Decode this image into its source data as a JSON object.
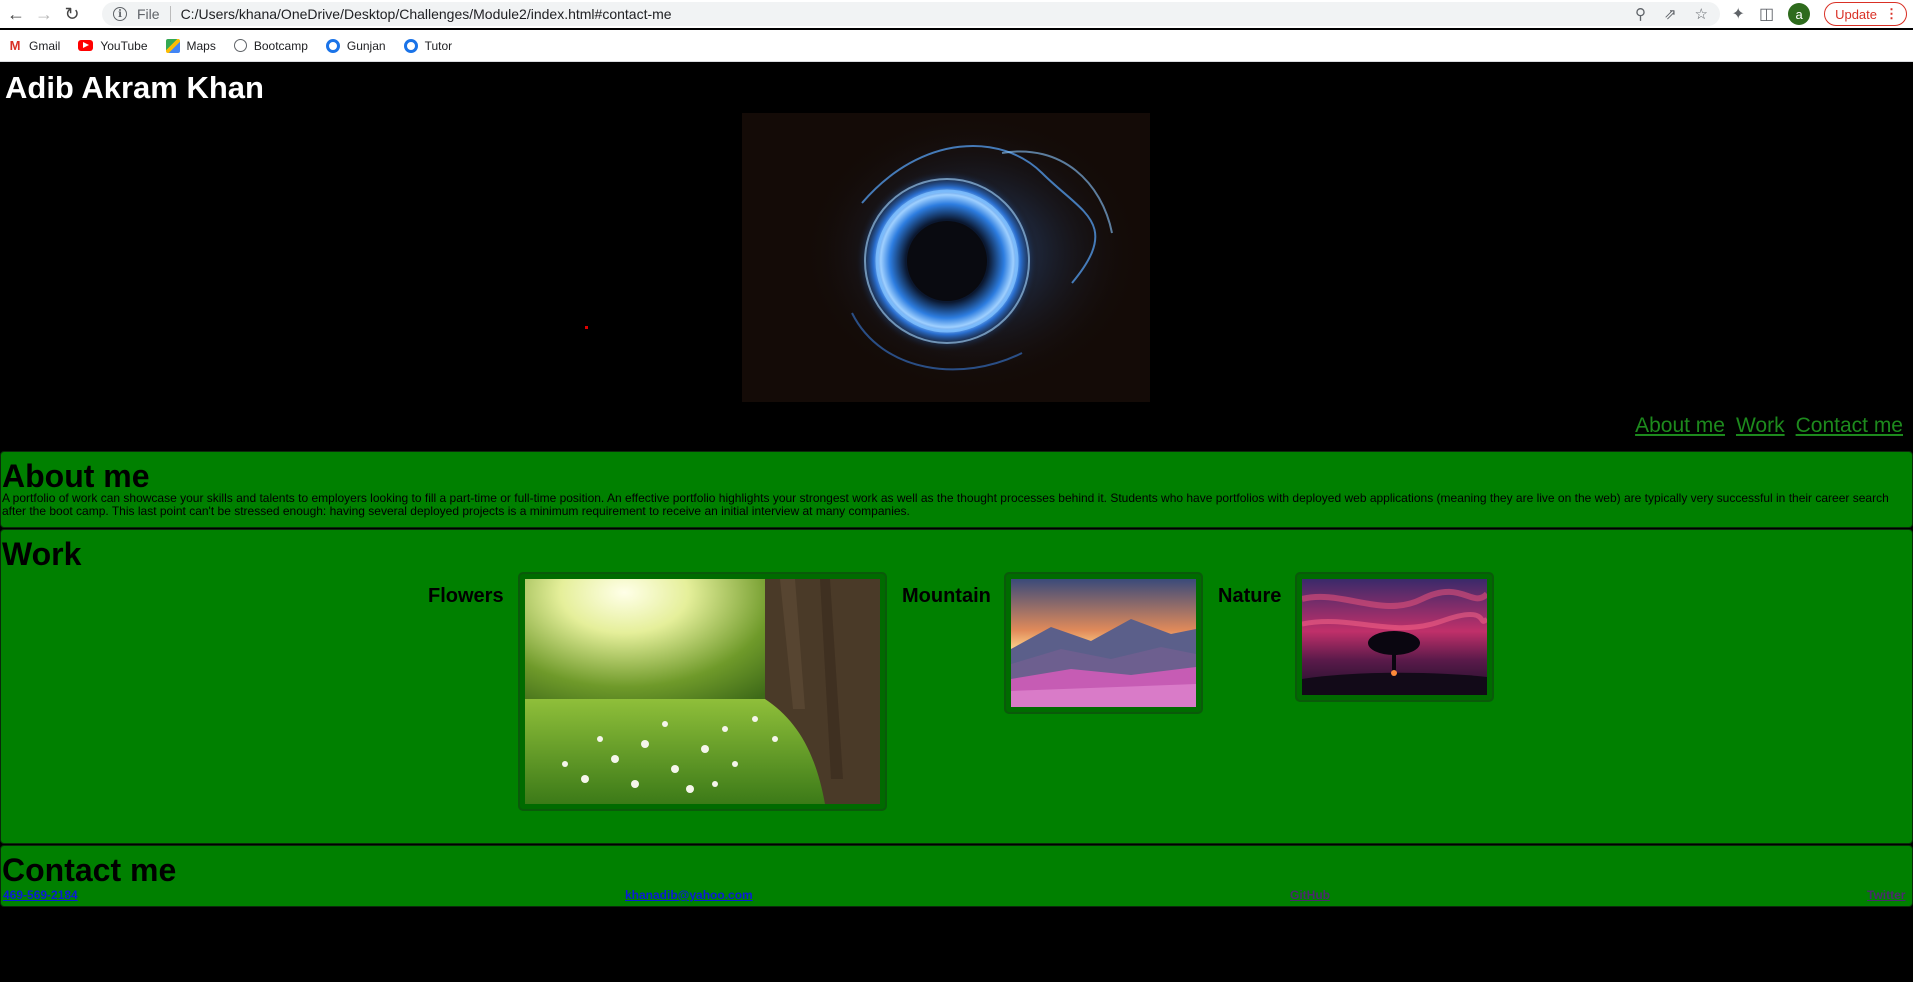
{
  "browser": {
    "url": "C:/Users/khana/OneDrive/Desktop/Challenges/Module2/index.html#contact-me",
    "file_label": "File",
    "profile_initial": "a",
    "update_label": "Update",
    "bookmarks": [
      {
        "label": "Gmail",
        "icon": "gmail-icon"
      },
      {
        "label": "YouTube",
        "icon": "youtube-icon"
      },
      {
        "label": "Maps",
        "icon": "maps-icon"
      },
      {
        "label": "Bootcamp",
        "icon": "globe-icon"
      },
      {
        "label": "Gunjan",
        "icon": "circle-icon"
      },
      {
        "label": "Tutor",
        "icon": "circle-icon"
      }
    ]
  },
  "site": {
    "title": "Adib Akram Khan",
    "nav": [
      "About me",
      "Work",
      "Contact me"
    ],
    "about": {
      "heading": "About me",
      "text": "A portfolio of work can showcase your skills and talents to employers looking to fill a part-time or full-time position. An effective portfolio highlights your strongest work as well as the thought processes behind it. Students who have portfolios with deployed web applications (meaning they are live on the web) are typically very successful in their career search after the boot camp. This last point can't be stressed enough: having several deployed projects is a minimum requirement to receive an initial interview at many companies."
    },
    "work": {
      "heading": "Work",
      "items": [
        "Flowers",
        "Mountain",
        "Nature"
      ]
    },
    "contact": {
      "heading": "Contact me",
      "phone": "469-569-2184",
      "email": "khanadib@yahoo.com",
      "github": "GitHub",
      "twitter": "Twitter"
    }
  },
  "colors": {
    "section_bg": "#008000",
    "nav_link": "#1d8a1d",
    "page_bg": "#000000"
  }
}
